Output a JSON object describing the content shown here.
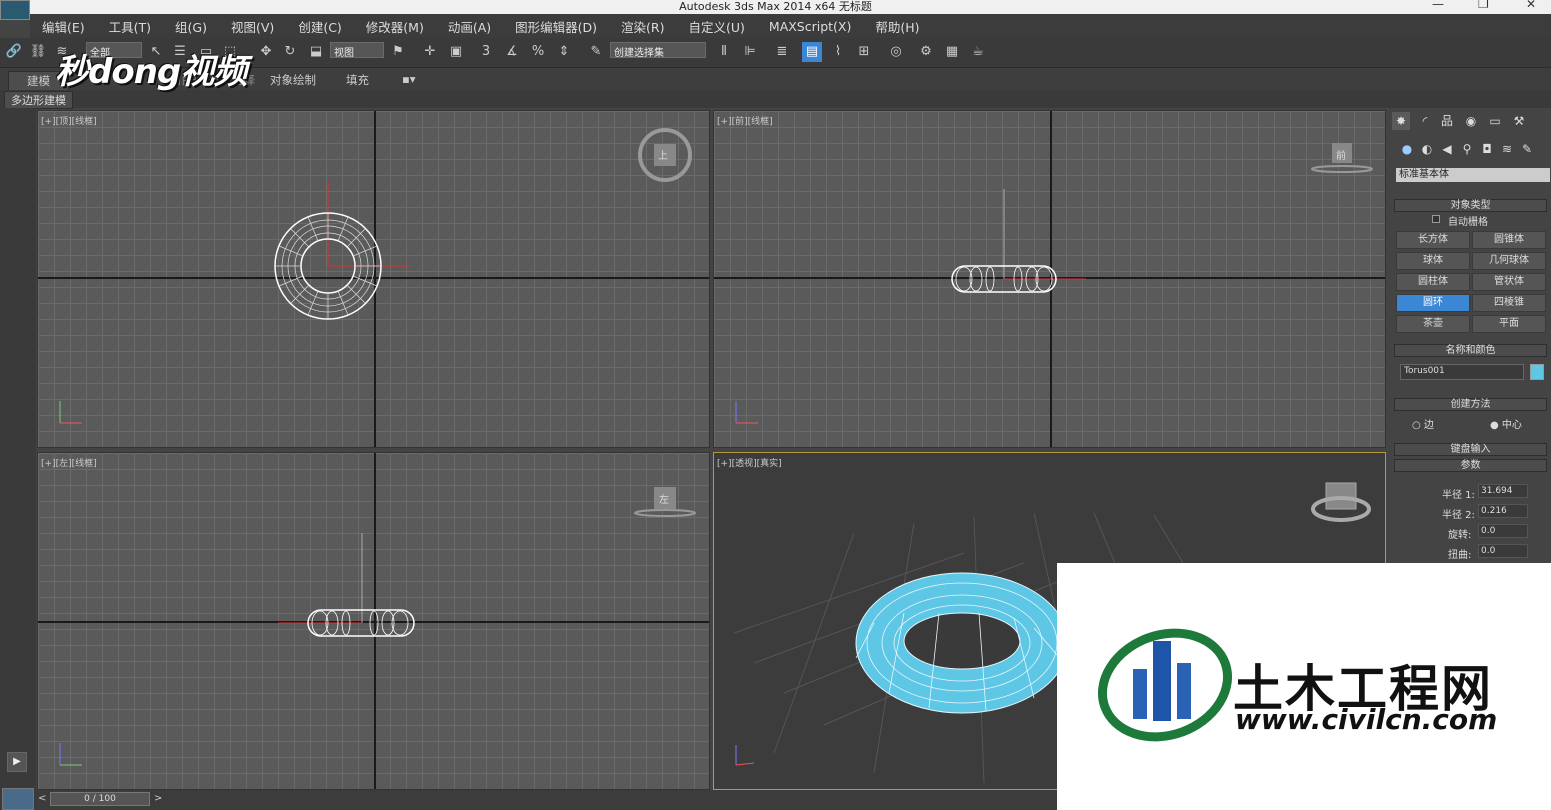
{
  "title_bar": {
    "title": "Autodesk 3ds Max  2014 x64     无标题",
    "minimize": "—",
    "restore": "❐",
    "close": "✕"
  },
  "menu": [
    "编辑(E)",
    "工具(T)",
    "组(G)",
    "视图(V)",
    "创建(C)",
    "修改器(M)",
    "动画(A)",
    "图形编辑器(D)",
    "渲染(R)",
    "自定义(U)",
    "MAXScript(X)",
    "帮助(H)"
  ],
  "toolbar": {
    "selection_filter": "全部",
    "ref_coord": "视图",
    "named_sel": "创建选择集"
  },
  "ribbon": {
    "tabs": [
      "建模",
      "自由形式",
      "选择",
      "对象绘制",
      "填充"
    ],
    "sub": "多边形建模"
  },
  "watermark": "秒dong视频",
  "viewports": {
    "top": "[+][顶][线框]",
    "front": "[+][前][线框]",
    "left": "[+][左][线框]",
    "persp": "[+][透视][真实]",
    "viewcube_top": "上",
    "viewcube_front": "前",
    "viewcube_left": "左"
  },
  "command_panel": {
    "category_dropdown": "标准基本体",
    "rollout_object_type": "对象类型",
    "auto_grid": "自动栅格",
    "objects": [
      "长方体",
      "圆锥体",
      "球体",
      "几何球体",
      "圆柱体",
      "管状体",
      "圆环",
      "四棱锥",
      "茶壶",
      "平面"
    ],
    "selected_object": "圆环",
    "rollout_name_color": "名称和颜色",
    "object_name": "Torus001",
    "object_color": "#5fc7e6",
    "rollout_creation": "创建方法",
    "creation_edge": "边",
    "creation_center": "中心",
    "rollout_keyboard": "键盘输入",
    "rollout_params": "参数",
    "params": [
      {
        "label": "半径 1:",
        "value": "31.694"
      },
      {
        "label": "半径 2:",
        "value": "0.216"
      },
      {
        "label": "旋转:",
        "value": "0.0"
      },
      {
        "label": "扭曲:",
        "value": "0.0"
      }
    ]
  },
  "timeline": {
    "frame": "0 / 100",
    "prev": "<",
    "next": ">"
  },
  "logo": {
    "cn": "土木工程网",
    "url": "www.civilcn.com"
  },
  "colors": {
    "torus": "#5fc7e6",
    "selected_btn": "#3b87d4",
    "persp_border": "#b79a3a"
  }
}
